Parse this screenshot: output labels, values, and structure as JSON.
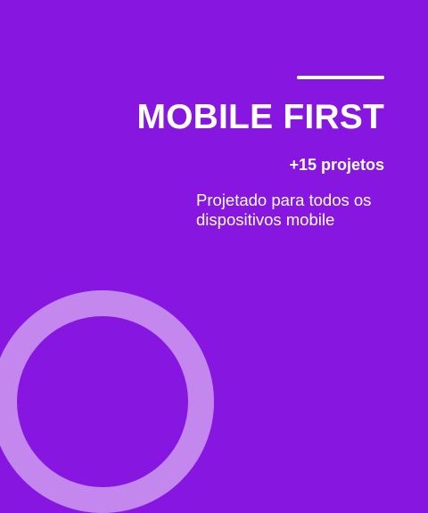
{
  "hero": {
    "title": "MOBILE FIRST",
    "project_count": "+15 projetos",
    "description": "Projetado para todos os dispositivos mobile"
  },
  "colors": {
    "background": "#8716e0",
    "ring": "#c387ee",
    "text": "#ffffff"
  }
}
